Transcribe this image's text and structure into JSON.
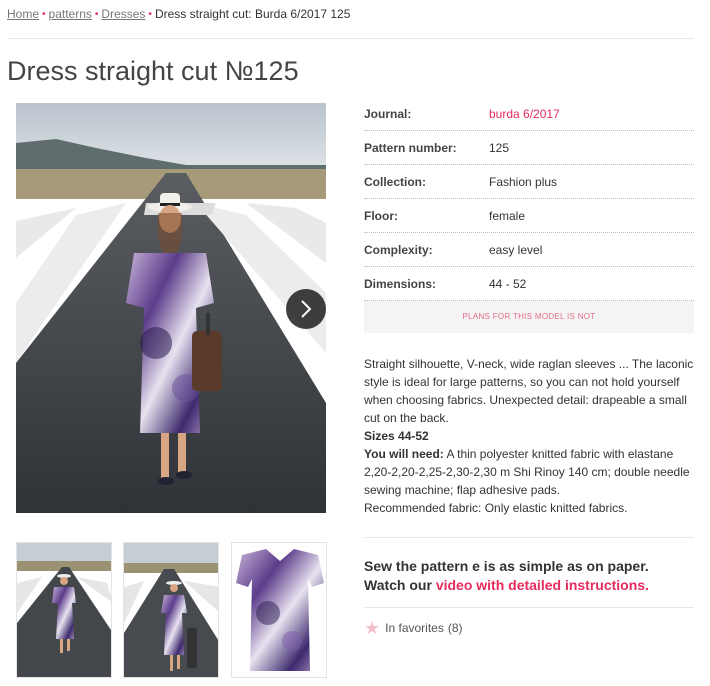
{
  "breadcrumb": {
    "home": "Home",
    "patterns": "patterns",
    "dresses": "Dresses",
    "current": "Dress straight cut: Burda 6/2017 125",
    "separator": "•"
  },
  "title": "Dress straight cut №125",
  "specs": [
    {
      "label": "Journal:",
      "value": "burda 6/2017"
    },
    {
      "label": "Pattern number:",
      "value": "125"
    },
    {
      "label": "Collection:",
      "value": "Fashion plus"
    },
    {
      "label": "Floor:",
      "value": "female"
    },
    {
      "label": "Complexity:",
      "value": "easy level"
    },
    {
      "label": "Dimensions:",
      "value": "44 - 52"
    }
  ],
  "plans_notice": "PLANS FOR THIS MODEL IS NOT",
  "description": {
    "text": "Straight silhouette, V-neck, wide raglan sleeves ... The laconic style is ideal for large patterns, so you can not hold yourself when choosing fabrics. Unexpected detail: drapeable a small cut on the back.",
    "sizes": "Sizes 44-52",
    "you_will_need_label": "You will need:",
    "you_will_need_text": " A thin polyester knitted fabric with elastane 2,20-2,20-2,25-2,30-2,30 m Shi Rinoy 140 cm; double needle sewing machine; flap adhesive pads.",
    "recommended": "Recommended fabric: Only elastic knitted fabrics."
  },
  "video": {
    "line1": "Sew the pattern e is as simple as on paper.",
    "line2_prefix": "Watch our ",
    "link": "video with detailed instructions."
  },
  "favorites": {
    "label": "In favorites",
    "count": "(8)"
  },
  "icons": {
    "next": "chevron-right-icon",
    "favorite": "star-icon"
  },
  "colors": {
    "accent": "#e62c5c",
    "breadcrumb_link": "#777777",
    "muted_background": "#f4f4f4"
  }
}
